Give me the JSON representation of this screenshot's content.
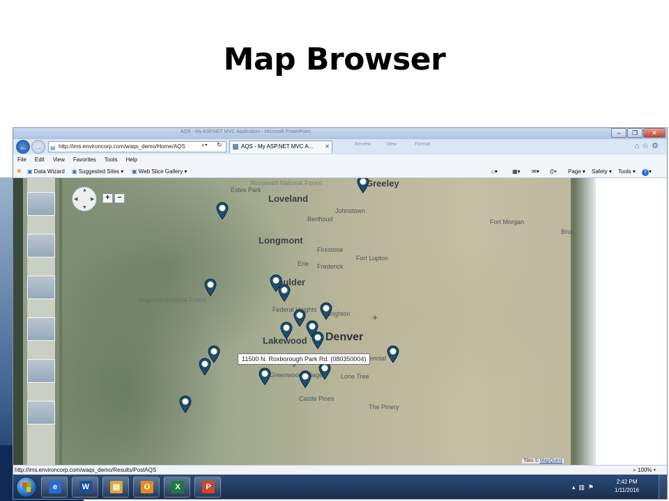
{
  "slide": {
    "title": "Map Browser"
  },
  "browser": {
    "title_text": "AQS - My ASP.NET MVC Application - Microsoft PowerPoint",
    "url": "http://ims.environcorp.com/waqs_demo/Home/AQS",
    "tab_label": "AQS - My ASP.NET MVC A...",
    "ghost_tabs": [
      "Review",
      "View",
      "Format"
    ],
    "window_buttons": {
      "minimize": "–",
      "restore": "❐",
      "close": "✕"
    },
    "menu": [
      "File",
      "Edit",
      "View",
      "Favorites",
      "Tools",
      "Help"
    ],
    "favorites": [
      {
        "label": "Data Wizard",
        "icon": "ie-page-icon"
      },
      {
        "label": "Suggested Sites ▾",
        "icon": "ie-page-icon"
      },
      {
        "label": "Web Slice Gallery ▾",
        "icon": "ie-page-icon"
      }
    ],
    "commands": [
      "Page ▾",
      "Safety ▾",
      "Tools ▾"
    ],
    "status_url": "http://ims.environcorp.com/waqs_demo/Results/PostAQS",
    "zoom": "100%"
  },
  "map": {
    "cities": [
      {
        "name": "Greeley",
        "size": "lg"
      },
      {
        "name": "Estes Park",
        "size": "sm"
      },
      {
        "name": "Loveland",
        "size": "lg"
      },
      {
        "name": "Johnstown",
        "size": "sm"
      },
      {
        "name": "Berthoud",
        "size": "sm"
      },
      {
        "name": "Fort Morgan",
        "size": "sm"
      },
      {
        "name": "Brus",
        "size": "sm"
      },
      {
        "name": "Longmont",
        "size": "lg"
      },
      {
        "name": "Firestone",
        "size": "sm"
      },
      {
        "name": "Fort Lupton",
        "size": "sm"
      },
      {
        "name": "Erie",
        "size": "sm"
      },
      {
        "name": "Frederick",
        "size": "sm"
      },
      {
        "name": "Boulder",
        "size": "lg"
      },
      {
        "name": "Federal Heights",
        "size": "sm"
      },
      {
        "name": "Brighton",
        "size": "sm"
      },
      {
        "name": "Denver",
        "size": "xl"
      },
      {
        "name": "Lakewood",
        "size": "lg"
      },
      {
        "name": "Greenwood Village",
        "size": "sm"
      },
      {
        "name": "Lone Tree",
        "size": "sm"
      },
      {
        "name": "Centennial",
        "size": "sm"
      },
      {
        "name": "Castle Pines",
        "size": "sm"
      },
      {
        "name": "The Pinery",
        "size": "sm"
      },
      {
        "name": "Arapaho National Forest",
        "size": "sm"
      },
      {
        "name": "Roosevelt National Forest",
        "size": "sm"
      }
    ],
    "tooltip": "11500 N. Roxborough Park Rd. (080350004)",
    "pin_color": "#1f4e6e",
    "zoom_in": "+",
    "zoom_out": "−",
    "attribution_prefix": "Tiles ©",
    "attribution_link": "MapQuest"
  },
  "taskbar": {
    "apps": [
      {
        "name": "internet-explorer",
        "glyph": "e",
        "color": "#2a6bd0"
      },
      {
        "name": "word",
        "glyph": "W",
        "color": "#1e4e9b"
      },
      {
        "name": "file-explorer",
        "glyph": "▤",
        "color": "#d7a83c"
      },
      {
        "name": "outlook",
        "glyph": "O",
        "color": "#e38b1e"
      },
      {
        "name": "excel",
        "glyph": "X",
        "color": "#1f7a3d"
      },
      {
        "name": "powerpoint",
        "glyph": "P",
        "color": "#c9482b"
      }
    ],
    "time": "2:42 PM",
    "date": "1/11/2016"
  }
}
